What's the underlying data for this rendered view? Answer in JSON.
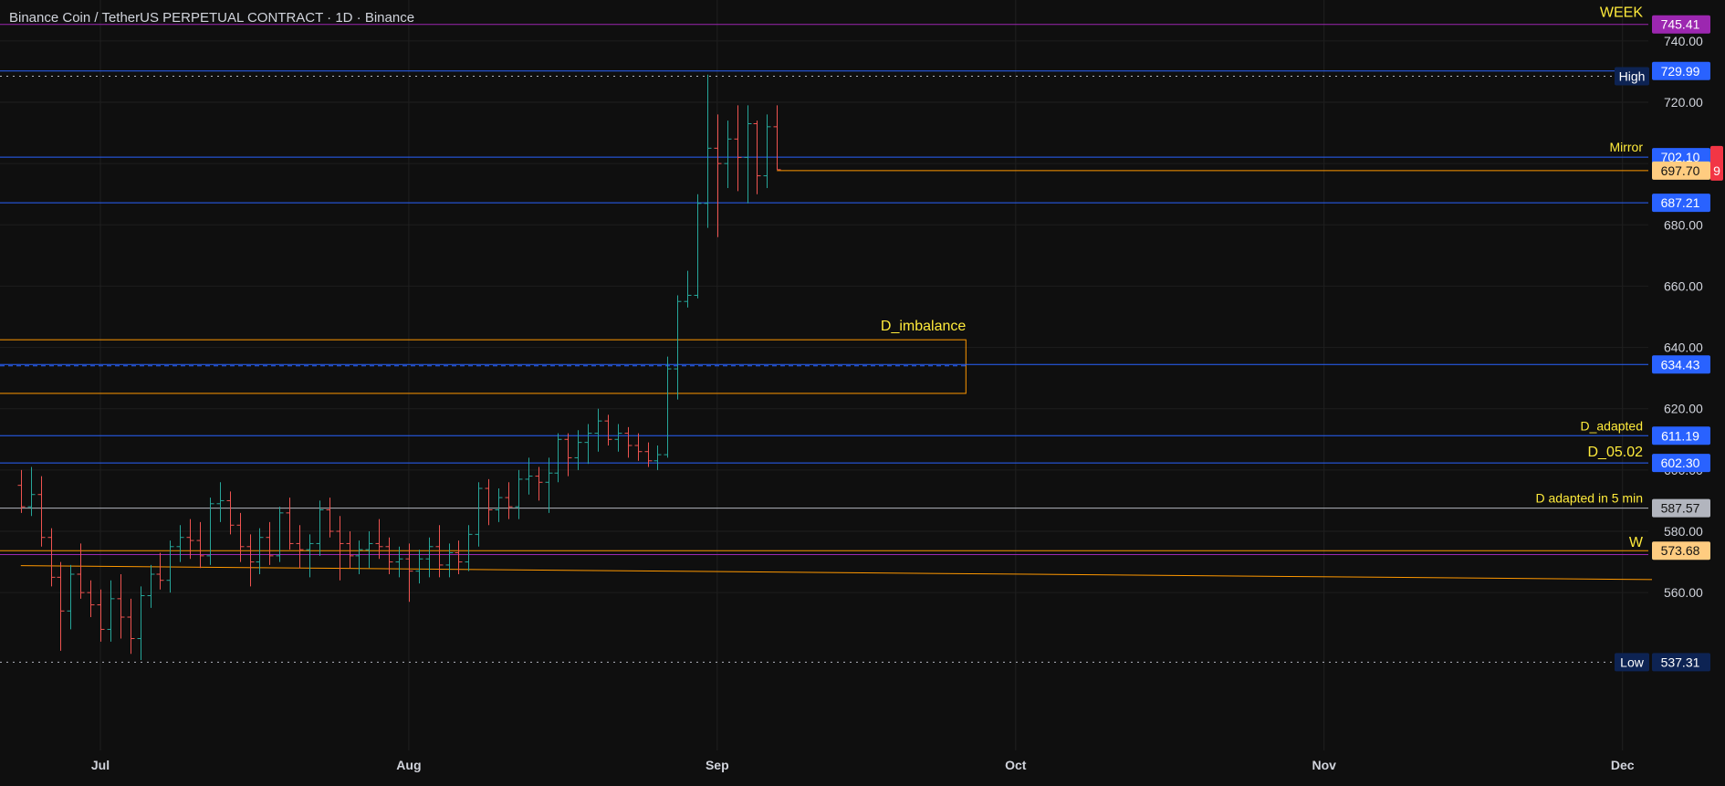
{
  "header": {
    "title": "Binance Coin / TetherUS PERPETUAL CONTRACT · 1D · Binance"
  },
  "colors": {
    "background": "#0f0f0f",
    "grid": "#1f1f1f",
    "text": "#d1d4dc",
    "up": "#26a69a",
    "down": "#ef5350",
    "blue_line": "#2962ff",
    "orange": "#ff9800",
    "yellow_label": "#ffeb3b",
    "purple": "#9c27b0",
    "gray_line": "#b2b5be"
  },
  "chart_data": {
    "type": "ohlc",
    "title": "Binance Coin / TetherUS PERPETUAL CONTRACT · 1D · Binance",
    "x_start": "2024-06-23",
    "x_end": "2024-12-06",
    "ylim": [
      524,
      748
    ],
    "y_ticks": [
      560,
      580,
      600,
      620,
      640,
      660,
      680,
      700,
      720,
      740
    ],
    "y_tick_labels": [
      "560.00",
      "580.00",
      "600.00",
      "620.00",
      "640.00",
      "660.00",
      "680.00",
      "700.00",
      "720.00",
      "740.00"
    ],
    "x_ticks": [
      {
        "date": "2024-07-01",
        "label": "Jul"
      },
      {
        "date": "2024-08-01",
        "label": "Aug"
      },
      {
        "date": "2024-09-01",
        "label": "Sep"
      },
      {
        "date": "2024-10-01",
        "label": "Oct"
      },
      {
        "date": "2024-11-01",
        "label": "Nov"
      },
      {
        "date": "2024-12-01",
        "label": "Dec"
      }
    ],
    "bars": [
      {
        "date": "2024-06-23",
        "o": 595,
        "h": 600,
        "l": 586,
        "c": 588
      },
      {
        "date": "2024-06-24",
        "o": 588,
        "h": 601,
        "l": 585,
        "c": 592
      },
      {
        "date": "2024-06-25",
        "o": 592,
        "h": 598,
        "l": 575,
        "c": 578
      },
      {
        "date": "2024-06-26",
        "o": 578,
        "h": 581,
        "l": 562,
        "c": 565
      },
      {
        "date": "2024-06-27",
        "o": 565,
        "h": 570,
        "l": 541,
        "c": 554
      },
      {
        "date": "2024-06-28",
        "o": 554,
        "h": 569,
        "l": 548,
        "c": 566
      },
      {
        "date": "2024-06-29",
        "o": 566,
        "h": 576,
        "l": 558,
        "c": 560
      },
      {
        "date": "2024-06-30",
        "o": 560,
        "h": 564,
        "l": 552,
        "c": 556
      },
      {
        "date": "2024-07-01",
        "o": 556,
        "h": 561,
        "l": 544,
        "c": 548
      },
      {
        "date": "2024-07-02",
        "o": 548,
        "h": 564,
        "l": 544,
        "c": 558
      },
      {
        "date": "2024-07-03",
        "o": 558,
        "h": 566,
        "l": 545,
        "c": 552
      },
      {
        "date": "2024-07-04",
        "o": 552,
        "h": 558,
        "l": 540,
        "c": 545
      },
      {
        "date": "2024-07-05",
        "o": 545,
        "h": 562,
        "l": 538,
        "c": 559
      },
      {
        "date": "2024-07-06",
        "o": 559,
        "h": 569,
        "l": 555,
        "c": 566
      },
      {
        "date": "2024-07-07",
        "o": 566,
        "h": 573,
        "l": 561,
        "c": 564
      },
      {
        "date": "2024-07-08",
        "o": 564,
        "h": 577,
        "l": 560,
        "c": 575
      },
      {
        "date": "2024-07-09",
        "o": 575,
        "h": 582,
        "l": 570,
        "c": 578
      },
      {
        "date": "2024-07-10",
        "o": 578,
        "h": 584,
        "l": 571,
        "c": 577
      },
      {
        "date": "2024-07-11",
        "o": 577,
        "h": 583,
        "l": 568,
        "c": 572
      },
      {
        "date": "2024-07-12",
        "o": 572,
        "h": 591,
        "l": 569,
        "c": 589
      },
      {
        "date": "2024-07-13",
        "o": 589,
        "h": 596,
        "l": 583,
        "c": 590
      },
      {
        "date": "2024-07-14",
        "o": 590,
        "h": 593,
        "l": 579,
        "c": 582
      },
      {
        "date": "2024-07-15",
        "o": 582,
        "h": 586,
        "l": 570,
        "c": 575
      },
      {
        "date": "2024-07-16",
        "o": 575,
        "h": 579,
        "l": 562,
        "c": 570
      },
      {
        "date": "2024-07-17",
        "o": 570,
        "h": 581,
        "l": 566,
        "c": 578
      },
      {
        "date": "2024-07-18",
        "o": 578,
        "h": 583,
        "l": 569,
        "c": 572
      },
      {
        "date": "2024-07-19",
        "o": 572,
        "h": 588,
        "l": 570,
        "c": 586
      },
      {
        "date": "2024-07-20",
        "o": 586,
        "h": 591,
        "l": 574,
        "c": 576
      },
      {
        "date": "2024-07-21",
        "o": 576,
        "h": 582,
        "l": 568,
        "c": 574
      },
      {
        "date": "2024-07-22",
        "o": 574,
        "h": 579,
        "l": 565,
        "c": 576
      },
      {
        "date": "2024-07-23",
        "o": 576,
        "h": 590,
        "l": 572,
        "c": 587
      },
      {
        "date": "2024-07-24",
        "o": 587,
        "h": 591,
        "l": 578,
        "c": 580
      },
      {
        "date": "2024-07-25",
        "o": 580,
        "h": 585,
        "l": 564,
        "c": 576
      },
      {
        "date": "2024-07-26",
        "o": 576,
        "h": 580,
        "l": 568,
        "c": 572
      },
      {
        "date": "2024-07-27",
        "o": 572,
        "h": 577,
        "l": 566,
        "c": 574
      },
      {
        "date": "2024-07-28",
        "o": 574,
        "h": 580,
        "l": 568,
        "c": 576
      },
      {
        "date": "2024-07-29",
        "o": 576,
        "h": 584,
        "l": 571,
        "c": 575
      },
      {
        "date": "2024-07-30",
        "o": 575,
        "h": 578,
        "l": 566,
        "c": 570
      },
      {
        "date": "2024-07-31",
        "o": 570,
        "h": 575,
        "l": 565,
        "c": 571
      },
      {
        "date": "2024-08-01",
        "o": 571,
        "h": 576,
        "l": 557,
        "c": 567
      },
      {
        "date": "2024-08-02",
        "o": 567,
        "h": 574,
        "l": 563,
        "c": 571
      },
      {
        "date": "2024-08-03",
        "o": 571,
        "h": 578,
        "l": 565,
        "c": 575
      },
      {
        "date": "2024-08-04",
        "o": 575,
        "h": 582,
        "l": 565,
        "c": 569
      },
      {
        "date": "2024-08-05",
        "o": 569,
        "h": 576,
        "l": 565,
        "c": 573
      },
      {
        "date": "2024-08-06",
        "o": 573,
        "h": 577,
        "l": 566,
        "c": 570
      },
      {
        "date": "2024-08-07",
        "o": 570,
        "h": 582,
        "l": 567,
        "c": 579
      },
      {
        "date": "2024-08-08",
        "o": 579,
        "h": 596,
        "l": 575,
        "c": 594
      },
      {
        "date": "2024-08-09",
        "o": 594,
        "h": 597,
        "l": 582,
        "c": 587
      },
      {
        "date": "2024-08-10",
        "o": 587,
        "h": 594,
        "l": 583,
        "c": 591
      },
      {
        "date": "2024-08-11",
        "o": 591,
        "h": 596,
        "l": 584,
        "c": 588
      },
      {
        "date": "2024-08-12",
        "o": 588,
        "h": 600,
        "l": 584,
        "c": 597
      },
      {
        "date": "2024-08-13",
        "o": 597,
        "h": 604,
        "l": 592,
        "c": 598
      },
      {
        "date": "2024-08-14",
        "o": 598,
        "h": 601,
        "l": 590,
        "c": 596
      },
      {
        "date": "2024-08-15",
        "o": 596,
        "h": 604,
        "l": 586,
        "c": 599
      },
      {
        "date": "2024-08-16",
        "o": 599,
        "h": 612,
        "l": 596,
        "c": 610
      },
      {
        "date": "2024-08-17",
        "o": 610,
        "h": 612,
        "l": 598,
        "c": 604
      },
      {
        "date": "2024-08-18",
        "o": 604,
        "h": 613,
        "l": 600,
        "c": 609
      },
      {
        "date": "2024-08-19",
        "o": 609,
        "h": 615,
        "l": 602,
        "c": 612
      },
      {
        "date": "2024-08-20",
        "o": 612,
        "h": 620,
        "l": 606,
        "c": 616
      },
      {
        "date": "2024-08-21",
        "o": 616,
        "h": 618,
        "l": 608,
        "c": 610
      },
      {
        "date": "2024-08-22",
        "o": 610,
        "h": 615,
        "l": 606,
        "c": 612
      },
      {
        "date": "2024-08-23",
        "o": 612,
        "h": 614,
        "l": 604,
        "c": 608
      },
      {
        "date": "2024-08-24",
        "o": 608,
        "h": 612,
        "l": 603,
        "c": 606
      },
      {
        "date": "2024-08-25",
        "o": 606,
        "h": 609,
        "l": 601,
        "c": 603
      },
      {
        "date": "2024-08-26",
        "o": 603,
        "h": 608,
        "l": 600,
        "c": 605
      },
      {
        "date": "2024-08-27",
        "o": 605,
        "h": 637,
        "l": 604,
        "c": 633
      },
      {
        "date": "2024-08-28",
        "o": 633,
        "h": 657,
        "l": 623,
        "c": 655
      },
      {
        "date": "2024-08-29",
        "o": 655,
        "h": 665,
        "l": 653,
        "c": 657
      },
      {
        "date": "2024-08-30",
        "o": 657,
        "h": 690,
        "l": 656,
        "c": 687
      },
      {
        "date": "2024-08-31",
        "o": 687,
        "h": 729,
        "l": 679,
        "c": 705
      },
      {
        "date": "2024-09-01",
        "o": 705,
        "h": 716,
        "l": 676,
        "c": 700
      },
      {
        "date": "2024-09-02",
        "o": 700,
        "h": 714,
        "l": 692,
        "c": 708
      },
      {
        "date": "2024-09-03",
        "o": 708,
        "h": 719,
        "l": 691,
        "c": 702
      },
      {
        "date": "2024-09-04",
        "o": 702,
        "h": 719,
        "l": 687,
        "c": 713
      },
      {
        "date": "2024-09-05",
        "o": 713,
        "h": 714,
        "l": 690,
        "c": 696
      },
      {
        "date": "2024-09-06",
        "o": 696,
        "h": 716,
        "l": 692,
        "c": 712
      },
      {
        "date": "2024-09-07",
        "o": 712,
        "h": 719,
        "l": 698,
        "c": 698
      }
    ],
    "levels": [
      {
        "price": 745.41,
        "color": "#9c27b0",
        "style": "solid",
        "extent": "full",
        "label": "WEEK",
        "price_label": "745.41"
      },
      {
        "price": 730.2,
        "color": "#2962ff",
        "style": "solid",
        "extent": "full",
        "label": "",
        "price_label": "729.99"
      },
      {
        "price": 728.5,
        "color": "#b2b5be",
        "style": "dotted",
        "extent": "full",
        "label": "High",
        "price_label": ""
      },
      {
        "price": 702.1,
        "color": "#2962ff",
        "style": "solid",
        "extent": "full",
        "label": "Mirror",
        "price_label": "702.10"
      },
      {
        "price": 697.7,
        "color": "#ff9800",
        "style": "solid",
        "extent": "from_last",
        "label": "",
        "price_label": "697.70"
      },
      {
        "price": 687.21,
        "color": "#2962ff",
        "style": "solid",
        "extent": "full",
        "label": "",
        "price_label": "687.21"
      },
      {
        "price": 634.43,
        "color": "#2962ff",
        "style": "solid",
        "extent": "full",
        "label": "",
        "price_label": "634.43"
      },
      {
        "price": 611.19,
        "color": "#2962ff",
        "style": "solid",
        "extent": "full",
        "label": "D_adapted",
        "price_label": "611.19"
      },
      {
        "price": 602.3,
        "color": "#2962ff",
        "style": "solid",
        "extent": "full",
        "label": "D_05.02",
        "price_label": "602.30"
      },
      {
        "price": 587.57,
        "color": "#b2b5be",
        "style": "solid",
        "extent": "full",
        "label": "D adapted in 5 min",
        "price_label": "587.57"
      },
      {
        "price": 573.68,
        "color": "#ff9800",
        "style": "solid",
        "extent": "full",
        "label": "W",
        "price_label": "573.68"
      },
      {
        "price": 572.4,
        "color": "#9c27b0",
        "style": "solid",
        "extent": "full",
        "label": "",
        "price_label": ""
      },
      {
        "price": 537.31,
        "color": "#b2b5be",
        "style": "dotted",
        "extent": "full",
        "label": "Low",
        "price_label": "537.31"
      }
    ],
    "imbalance_box": {
      "label": "D_imbalance",
      "top": 642.5,
      "bottom": 625,
      "mid": 634,
      "start": "2024-06-23",
      "end": "2024-09-26",
      "color": "#ff9800"
    },
    "trendline": {
      "from_date": "2024-06-23",
      "from_price": 568.8,
      "to_date": "2024-12-06",
      "to_price": 564.2,
      "color": "#ff9800"
    },
    "last_price_badge": {
      "text": "9",
      "color": "#f23645"
    },
    "high": {
      "label": "High",
      "value": "729.99"
    },
    "low": {
      "label": "Low",
      "value": "537.31"
    }
  }
}
